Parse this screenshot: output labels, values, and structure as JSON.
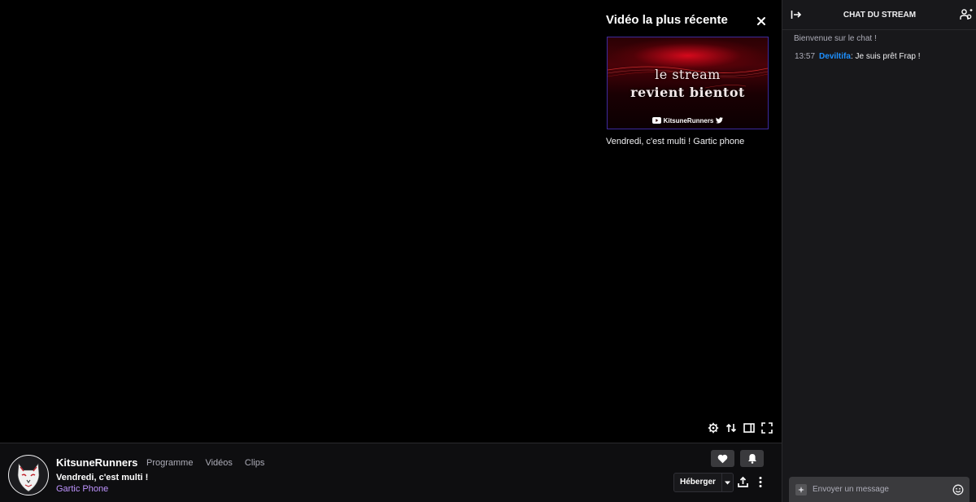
{
  "overlay": {
    "title": "Vidéo la plus récente",
    "thumbnail": {
      "line1": "le stream",
      "line2": "revient bientot",
      "brand": "KitsuneRunners"
    },
    "description": "Vendredi, c'est multi ! Gartic phone"
  },
  "player_controls": [
    "settings-icon",
    "swap-icon",
    "theatre-mode-icon",
    "fullscreen-icon"
  ],
  "channel": {
    "name": "KitsuneRunners",
    "nav": [
      "Programme",
      "Vidéos",
      "Clips"
    ],
    "stream_title": "Vendredi, c'est multi !",
    "game": "Gartic Phone",
    "host_label": "Héberger"
  },
  "chat": {
    "title": "CHAT DU STREAM",
    "welcome": "Bienvenue sur le chat !",
    "messages": [
      {
        "time": "13:57",
        "user": "Deviltifa",
        "user_color": "#1e90ff",
        "sep": ":",
        "text": "Je suis prêt Frap !"
      }
    ],
    "input_placeholder": "Envoyer un message"
  },
  "colors": {
    "accent": "#bf94ff",
    "background": "#0e0e10",
    "chat_bg": "#18181b"
  }
}
